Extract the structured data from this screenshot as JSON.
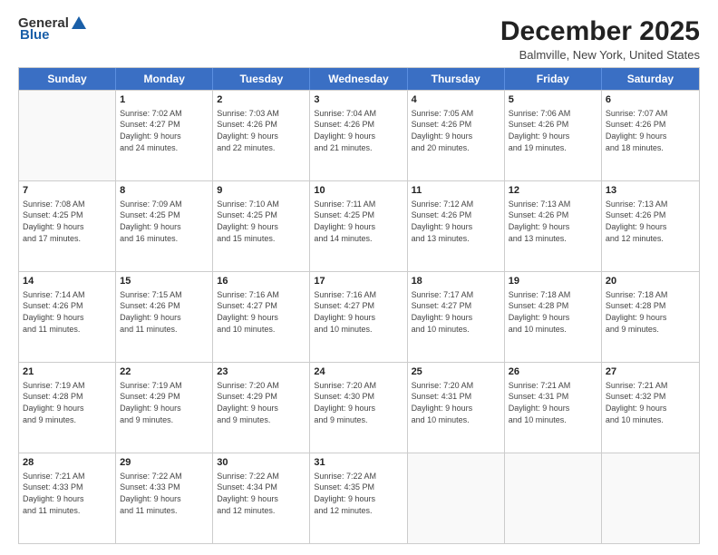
{
  "logo": {
    "general": "General",
    "blue": "Blue"
  },
  "title": "December 2025",
  "subtitle": "Balmville, New York, United States",
  "days": [
    "Sunday",
    "Monday",
    "Tuesday",
    "Wednesday",
    "Thursday",
    "Friday",
    "Saturday"
  ],
  "weeks": [
    [
      {
        "day": "",
        "info": ""
      },
      {
        "day": "1",
        "info": "Sunrise: 7:02 AM\nSunset: 4:27 PM\nDaylight: 9 hours\nand 24 minutes."
      },
      {
        "day": "2",
        "info": "Sunrise: 7:03 AM\nSunset: 4:26 PM\nDaylight: 9 hours\nand 22 minutes."
      },
      {
        "day": "3",
        "info": "Sunrise: 7:04 AM\nSunset: 4:26 PM\nDaylight: 9 hours\nand 21 minutes."
      },
      {
        "day": "4",
        "info": "Sunrise: 7:05 AM\nSunset: 4:26 PM\nDaylight: 9 hours\nand 20 minutes."
      },
      {
        "day": "5",
        "info": "Sunrise: 7:06 AM\nSunset: 4:26 PM\nDaylight: 9 hours\nand 19 minutes."
      },
      {
        "day": "6",
        "info": "Sunrise: 7:07 AM\nSunset: 4:26 PM\nDaylight: 9 hours\nand 18 minutes."
      }
    ],
    [
      {
        "day": "7",
        "info": "Sunrise: 7:08 AM\nSunset: 4:25 PM\nDaylight: 9 hours\nand 17 minutes."
      },
      {
        "day": "8",
        "info": "Sunrise: 7:09 AM\nSunset: 4:25 PM\nDaylight: 9 hours\nand 16 minutes."
      },
      {
        "day": "9",
        "info": "Sunrise: 7:10 AM\nSunset: 4:25 PM\nDaylight: 9 hours\nand 15 minutes."
      },
      {
        "day": "10",
        "info": "Sunrise: 7:11 AM\nSunset: 4:25 PM\nDaylight: 9 hours\nand 14 minutes."
      },
      {
        "day": "11",
        "info": "Sunrise: 7:12 AM\nSunset: 4:26 PM\nDaylight: 9 hours\nand 13 minutes."
      },
      {
        "day": "12",
        "info": "Sunrise: 7:13 AM\nSunset: 4:26 PM\nDaylight: 9 hours\nand 13 minutes."
      },
      {
        "day": "13",
        "info": "Sunrise: 7:13 AM\nSunset: 4:26 PM\nDaylight: 9 hours\nand 12 minutes."
      }
    ],
    [
      {
        "day": "14",
        "info": "Sunrise: 7:14 AM\nSunset: 4:26 PM\nDaylight: 9 hours\nand 11 minutes."
      },
      {
        "day": "15",
        "info": "Sunrise: 7:15 AM\nSunset: 4:26 PM\nDaylight: 9 hours\nand 11 minutes."
      },
      {
        "day": "16",
        "info": "Sunrise: 7:16 AM\nSunset: 4:27 PM\nDaylight: 9 hours\nand 10 minutes."
      },
      {
        "day": "17",
        "info": "Sunrise: 7:16 AM\nSunset: 4:27 PM\nDaylight: 9 hours\nand 10 minutes."
      },
      {
        "day": "18",
        "info": "Sunrise: 7:17 AM\nSunset: 4:27 PM\nDaylight: 9 hours\nand 10 minutes."
      },
      {
        "day": "19",
        "info": "Sunrise: 7:18 AM\nSunset: 4:28 PM\nDaylight: 9 hours\nand 10 minutes."
      },
      {
        "day": "20",
        "info": "Sunrise: 7:18 AM\nSunset: 4:28 PM\nDaylight: 9 hours\nand 9 minutes."
      }
    ],
    [
      {
        "day": "21",
        "info": "Sunrise: 7:19 AM\nSunset: 4:28 PM\nDaylight: 9 hours\nand 9 minutes."
      },
      {
        "day": "22",
        "info": "Sunrise: 7:19 AM\nSunset: 4:29 PM\nDaylight: 9 hours\nand 9 minutes."
      },
      {
        "day": "23",
        "info": "Sunrise: 7:20 AM\nSunset: 4:29 PM\nDaylight: 9 hours\nand 9 minutes."
      },
      {
        "day": "24",
        "info": "Sunrise: 7:20 AM\nSunset: 4:30 PM\nDaylight: 9 hours\nand 9 minutes."
      },
      {
        "day": "25",
        "info": "Sunrise: 7:20 AM\nSunset: 4:31 PM\nDaylight: 9 hours\nand 10 minutes."
      },
      {
        "day": "26",
        "info": "Sunrise: 7:21 AM\nSunset: 4:31 PM\nDaylight: 9 hours\nand 10 minutes."
      },
      {
        "day": "27",
        "info": "Sunrise: 7:21 AM\nSunset: 4:32 PM\nDaylight: 9 hours\nand 10 minutes."
      }
    ],
    [
      {
        "day": "28",
        "info": "Sunrise: 7:21 AM\nSunset: 4:33 PM\nDaylight: 9 hours\nand 11 minutes."
      },
      {
        "day": "29",
        "info": "Sunrise: 7:22 AM\nSunset: 4:33 PM\nDaylight: 9 hours\nand 11 minutes."
      },
      {
        "day": "30",
        "info": "Sunrise: 7:22 AM\nSunset: 4:34 PM\nDaylight: 9 hours\nand 12 minutes."
      },
      {
        "day": "31",
        "info": "Sunrise: 7:22 AM\nSunset: 4:35 PM\nDaylight: 9 hours\nand 12 minutes."
      },
      {
        "day": "",
        "info": ""
      },
      {
        "day": "",
        "info": ""
      },
      {
        "day": "",
        "info": ""
      }
    ]
  ]
}
